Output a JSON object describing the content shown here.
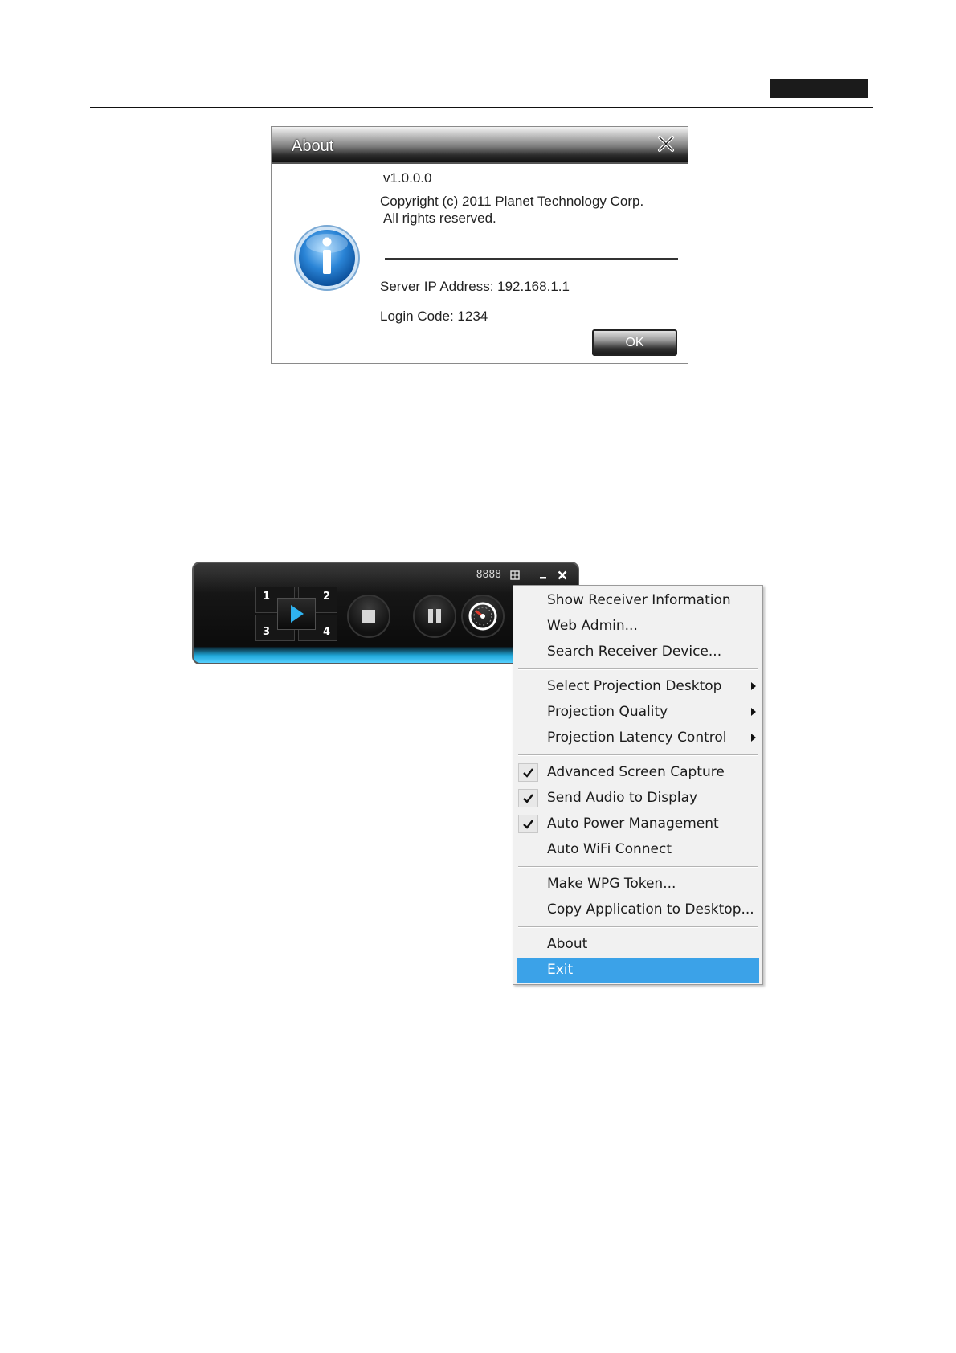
{
  "about_dialog": {
    "title": "About",
    "version": "v1.0.0.0",
    "copyright_line1": "Copyright (c) 2011 Planet Technology Corp.",
    "copyright_line2": "All rights reserved.",
    "server_ip": "Server IP Address: 192.168.1.1",
    "login_code": "Login Code: 1234",
    "ok_label": "OK",
    "icon": "info-icon"
  },
  "player": {
    "code": "8888",
    "quadrants": [
      "1",
      "2",
      "3",
      "4"
    ],
    "buttons": [
      "play-icon",
      "stop-icon",
      "pause-icon",
      "gauge-icon"
    ],
    "accent_color": "#1fa6d8"
  },
  "context_menu": {
    "groups": [
      [
        {
          "label": "Show Receiver Information"
        },
        {
          "label": "Web Admin..."
        },
        {
          "label": "Search Receiver Device..."
        }
      ],
      [
        {
          "label": "Select Projection Desktop",
          "submenu": true
        },
        {
          "label": "Projection Quality",
          "submenu": true
        },
        {
          "label": "Projection Latency Control",
          "submenu": true
        }
      ],
      [
        {
          "label": "Advanced Screen Capture",
          "checked": true
        },
        {
          "label": "Send Audio to Display",
          "checked": true
        },
        {
          "label": "Auto Power Management",
          "checked": true
        },
        {
          "label": "Auto WiFi Connect",
          "checked": false
        }
      ],
      [
        {
          "label": "Make WPG Token..."
        },
        {
          "label": "Copy Application to Desktop..."
        }
      ],
      [
        {
          "label": "About"
        },
        {
          "label": "Exit",
          "highlighted": true
        }
      ]
    ],
    "highlight_color": "#3ba2e8"
  }
}
